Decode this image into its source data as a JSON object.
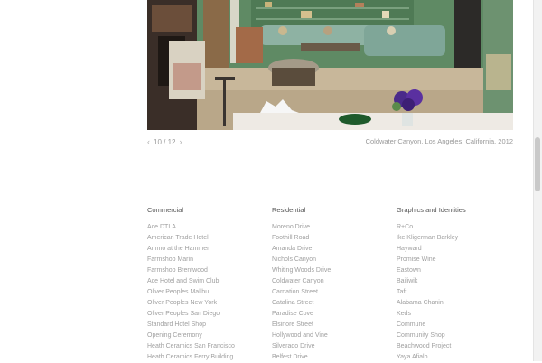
{
  "gallery": {
    "counter": "10 / 12",
    "caption": "Coldwater Canyon. Los Angeles, California. 2012"
  },
  "footer": {
    "columns": [
      {
        "heading": "Commercial",
        "items": [
          "Ace DTLA",
          "American Trade Hotel",
          "Ammo at the Hammer",
          "Farmshop Marin",
          "Farmshop Brentwood",
          "Ace Hotel and Swim Club",
          "Oliver Peoples Malibu",
          "Oliver Peoples New York",
          "Oliver Peoples San Diego",
          "Standard Hotel Shop",
          "Opening Ceremony",
          "Heath Ceramics San Francisco",
          "Heath Ceramics Ferry Building"
        ]
      },
      {
        "heading": "Residential",
        "items": [
          "Moreno Drive",
          "Foothill Road",
          "Amanda Drive",
          "Nichols Canyon",
          "Whiting Woods Drive",
          "Coldwater Canyon",
          "Carnation Street",
          "Catalina Street",
          "Paradise Cove",
          "Elsinore Street",
          "Hollywood and Vine",
          "Silverado Drive",
          "Belfest Drive"
        ]
      },
      {
        "heading": "Graphics and Identities",
        "items": [
          "R+Co",
          "Ike Kligerman Barkley",
          "Hayward",
          "Promise Wine",
          "Eastown",
          "Bailiwik",
          "Taft",
          "Alabama Chanin",
          "Keds",
          "Commune",
          "Community Shop",
          "Beachwood Project",
          "Yaya Afialo"
        ]
      }
    ]
  },
  "colors": {
    "wall": "#5f8a64",
    "rug": "#c8b79a",
    "text_muted": "#a0a0a0"
  }
}
